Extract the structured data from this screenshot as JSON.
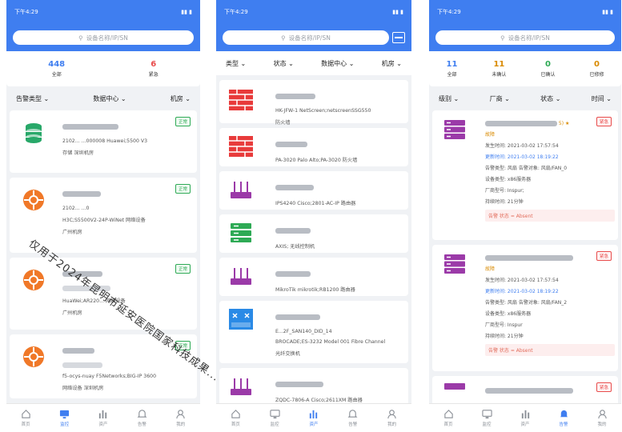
{
  "colors": {
    "primary": "#3f7ef0",
    "ok": "#2eaa55",
    "urgent": "#e84c4c",
    "unconfirmed": "#d98a00",
    "confirmed": "#2eaa55",
    "repaired": "#d98a00"
  },
  "status_time": "下午4:29",
  "search_placeholder": "设备名称/IP/SN",
  "screen1": {
    "stats": [
      {
        "num": "448",
        "label": "全部"
      },
      {
        "num": "6",
        "label": "紧急"
      }
    ],
    "filters": [
      "告警类型",
      "数据中心",
      "机房"
    ],
    "cards": [
      {
        "icon": "database-icon",
        "status": "正常",
        "line1": "2102... ...000008  Huawei;5500 V3",
        "line2": "存储  深圳机房"
      },
      {
        "icon": "network-icon",
        "status": "正常",
        "line1": "2102... ...0",
        "line2": "H3C;S5500V2-24P-WiNet  网络设备",
        "line3": "广州机房"
      },
      {
        "icon": "network-icon",
        "status": "正常",
        "line1": "HuaWei;AR220...  网络设备",
        "line2": "广州机房"
      },
      {
        "icon": "network-icon",
        "status": "正常",
        "line1": "f5-ocys-nuay  F5Networks;BIG-IP 3600",
        "line2": "网络设备  深圳机房"
      }
    ]
  },
  "screen2": {
    "filters": [
      "类型",
      "状态",
      "数据中心",
      "机房"
    ],
    "cards": [
      {
        "icon": "firewall-icon",
        "line1": "HK-JFW-1  NetScreen;netscreenSSG550",
        "line2": "防火墙"
      },
      {
        "icon": "firewall-icon",
        "line1": "PA-3020  Palo Alto;PA-3020  防火墙"
      },
      {
        "icon": "router-icon",
        "line1": "IPS4240  Cisco;2801-AC-IP  路由器"
      },
      {
        "icon": "wireless-controller-icon",
        "line1": "AXIS;  无线控制机"
      },
      {
        "icon": "router-icon",
        "line1": "MikroTik  mikrotik;RB1200  路由器"
      },
      {
        "icon": "fc-switch-icon",
        "line1": "E...2F_SAN140_DID_14",
        "line2": "BROCADE;ES-3232 Model 001 Fibre Channel",
        "line3": "光纤交换机"
      },
      {
        "icon": "router-icon",
        "line1": "ZQDC-7806-A  Cisco;2611XM  路由器"
      }
    ]
  },
  "screen3": {
    "stats": [
      {
        "num": "11",
        "label": "全部"
      },
      {
        "num": "11",
        "label": "未确认"
      },
      {
        "num": "0",
        "label": "已确认"
      },
      {
        "num": "0",
        "label": "已修修"
      }
    ],
    "filters": [
      "级别",
      "厂商",
      "状态",
      "时间"
    ],
    "alerts": [
      {
        "title_suffix": "5) ★",
        "badge": "紧急",
        "type": "故障",
        "occur": "发生时间: 2021-03-02 17:57:54",
        "update": "更新时间: 2021-03-02 18:19:22",
        "obj": "告警类型: 风扇  告警对象: 风扇/FAN_0",
        "svc": "设备类型: x86服务器",
        "vendor": "厂商型号: Inspur;",
        "dur": "持续时间: 21分钟",
        "strip": "告警  状态 = Absent"
      },
      {
        "title_suffix": "",
        "badge": "紧急",
        "type": "故障",
        "occur": "发生时间: 2021-03-02 17:57:54",
        "update": "更新时间: 2021-03-02 18:19:22",
        "obj": "告警类型: 风扇  告警对象: 风扇/FAN_2",
        "svc": "设备类型: x86服务器",
        "vendor": "厂商型号: Inspur",
        "dur": "持续时间: 21分钟",
        "strip": "告警  状态 = Absent"
      },
      {
        "title_suffix": "",
        "badge": "紧急"
      }
    ]
  },
  "tabs_s1": [
    {
      "label": "首页",
      "icon": "home-icon"
    },
    {
      "label": "监控",
      "icon": "monitor-icon"
    },
    {
      "label": "资产",
      "icon": "asset-icon"
    },
    {
      "label": "告警",
      "icon": "bell-icon"
    },
    {
      "label": "我的",
      "icon": "user-icon"
    }
  ],
  "tabs_s2": [
    {
      "label": "首页",
      "icon": "home-icon"
    },
    {
      "label": "监控",
      "icon": "monitor-icon"
    },
    {
      "label": "资产",
      "icon": "asset-icon"
    },
    {
      "label": "告警",
      "icon": "bell-icon"
    },
    {
      "label": "我的",
      "icon": "user-icon"
    }
  ],
  "tabs_s3": [
    {
      "label": "首页",
      "icon": "home-icon"
    },
    {
      "label": "监控",
      "icon": "monitor-icon"
    },
    {
      "label": "资产",
      "icon": "asset-icon"
    },
    {
      "label": "告警",
      "icon": "bell-icon"
    },
    {
      "label": "我的",
      "icon": "user-icon"
    }
  ],
  "watermark": "仅用于2024年昆明市延安医院国家科技成果..."
}
